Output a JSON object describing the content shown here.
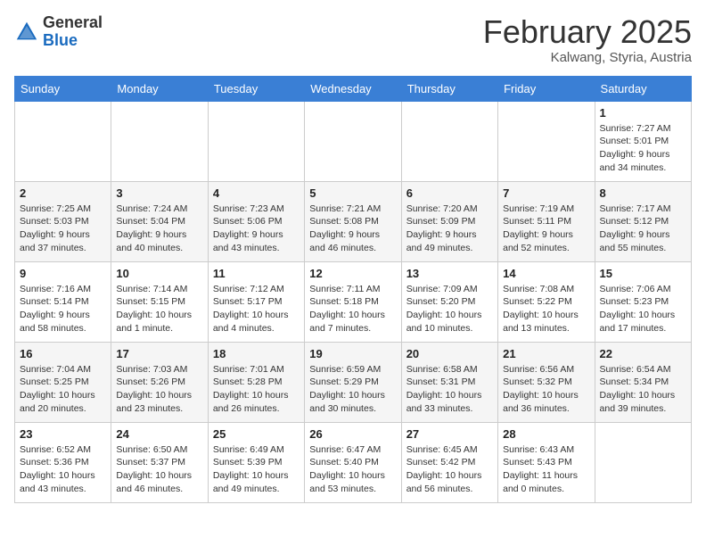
{
  "header": {
    "logo": {
      "text_general": "General",
      "text_blue": "Blue"
    },
    "title": "February 2025",
    "location": "Kalwang, Styria, Austria"
  },
  "weekdays": [
    "Sunday",
    "Monday",
    "Tuesday",
    "Wednesday",
    "Thursday",
    "Friday",
    "Saturday"
  ],
  "weeks": [
    [
      {
        "day": "",
        "info": ""
      },
      {
        "day": "",
        "info": ""
      },
      {
        "day": "",
        "info": ""
      },
      {
        "day": "",
        "info": ""
      },
      {
        "day": "",
        "info": ""
      },
      {
        "day": "",
        "info": ""
      },
      {
        "day": "1",
        "info": "Sunrise: 7:27 AM\nSunset: 5:01 PM\nDaylight: 9 hours and 34 minutes."
      }
    ],
    [
      {
        "day": "2",
        "info": "Sunrise: 7:25 AM\nSunset: 5:03 PM\nDaylight: 9 hours and 37 minutes."
      },
      {
        "day": "3",
        "info": "Sunrise: 7:24 AM\nSunset: 5:04 PM\nDaylight: 9 hours and 40 minutes."
      },
      {
        "day": "4",
        "info": "Sunrise: 7:23 AM\nSunset: 5:06 PM\nDaylight: 9 hours and 43 minutes."
      },
      {
        "day": "5",
        "info": "Sunrise: 7:21 AM\nSunset: 5:08 PM\nDaylight: 9 hours and 46 minutes."
      },
      {
        "day": "6",
        "info": "Sunrise: 7:20 AM\nSunset: 5:09 PM\nDaylight: 9 hours and 49 minutes."
      },
      {
        "day": "7",
        "info": "Sunrise: 7:19 AM\nSunset: 5:11 PM\nDaylight: 9 hours and 52 minutes."
      },
      {
        "day": "8",
        "info": "Sunrise: 7:17 AM\nSunset: 5:12 PM\nDaylight: 9 hours and 55 minutes."
      }
    ],
    [
      {
        "day": "9",
        "info": "Sunrise: 7:16 AM\nSunset: 5:14 PM\nDaylight: 9 hours and 58 minutes."
      },
      {
        "day": "10",
        "info": "Sunrise: 7:14 AM\nSunset: 5:15 PM\nDaylight: 10 hours and 1 minute."
      },
      {
        "day": "11",
        "info": "Sunrise: 7:12 AM\nSunset: 5:17 PM\nDaylight: 10 hours and 4 minutes."
      },
      {
        "day": "12",
        "info": "Sunrise: 7:11 AM\nSunset: 5:18 PM\nDaylight: 10 hours and 7 minutes."
      },
      {
        "day": "13",
        "info": "Sunrise: 7:09 AM\nSunset: 5:20 PM\nDaylight: 10 hours and 10 minutes."
      },
      {
        "day": "14",
        "info": "Sunrise: 7:08 AM\nSunset: 5:22 PM\nDaylight: 10 hours and 13 minutes."
      },
      {
        "day": "15",
        "info": "Sunrise: 7:06 AM\nSunset: 5:23 PM\nDaylight: 10 hours and 17 minutes."
      }
    ],
    [
      {
        "day": "16",
        "info": "Sunrise: 7:04 AM\nSunset: 5:25 PM\nDaylight: 10 hours and 20 minutes."
      },
      {
        "day": "17",
        "info": "Sunrise: 7:03 AM\nSunset: 5:26 PM\nDaylight: 10 hours and 23 minutes."
      },
      {
        "day": "18",
        "info": "Sunrise: 7:01 AM\nSunset: 5:28 PM\nDaylight: 10 hours and 26 minutes."
      },
      {
        "day": "19",
        "info": "Sunrise: 6:59 AM\nSunset: 5:29 PM\nDaylight: 10 hours and 30 minutes."
      },
      {
        "day": "20",
        "info": "Sunrise: 6:58 AM\nSunset: 5:31 PM\nDaylight: 10 hours and 33 minutes."
      },
      {
        "day": "21",
        "info": "Sunrise: 6:56 AM\nSunset: 5:32 PM\nDaylight: 10 hours and 36 minutes."
      },
      {
        "day": "22",
        "info": "Sunrise: 6:54 AM\nSunset: 5:34 PM\nDaylight: 10 hours and 39 minutes."
      }
    ],
    [
      {
        "day": "23",
        "info": "Sunrise: 6:52 AM\nSunset: 5:36 PM\nDaylight: 10 hours and 43 minutes."
      },
      {
        "day": "24",
        "info": "Sunrise: 6:50 AM\nSunset: 5:37 PM\nDaylight: 10 hours and 46 minutes."
      },
      {
        "day": "25",
        "info": "Sunrise: 6:49 AM\nSunset: 5:39 PM\nDaylight: 10 hours and 49 minutes."
      },
      {
        "day": "26",
        "info": "Sunrise: 6:47 AM\nSunset: 5:40 PM\nDaylight: 10 hours and 53 minutes."
      },
      {
        "day": "27",
        "info": "Sunrise: 6:45 AM\nSunset: 5:42 PM\nDaylight: 10 hours and 56 minutes."
      },
      {
        "day": "28",
        "info": "Sunrise: 6:43 AM\nSunset: 5:43 PM\nDaylight: 11 hours and 0 minutes."
      },
      {
        "day": "",
        "info": ""
      }
    ]
  ]
}
